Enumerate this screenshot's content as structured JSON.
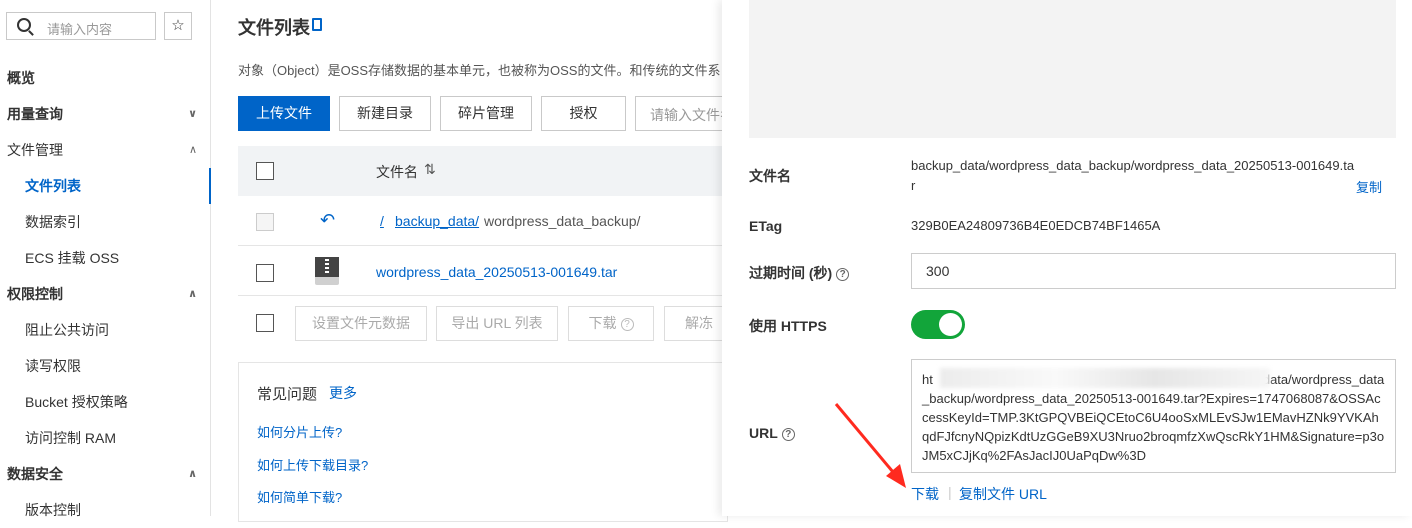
{
  "sidebar": {
    "search_placeholder": "请输入内容",
    "star_icon": "☆",
    "items": [
      {
        "label": "概览"
      },
      {
        "label": "用量查询"
      },
      {
        "label": "文件管理"
      },
      {
        "label": "文件列表"
      },
      {
        "label": "数据索引"
      },
      {
        "label": "ECS 挂载 OSS"
      },
      {
        "label": "权限控制"
      },
      {
        "label": "阻止公共访问"
      },
      {
        "label": "读写权限"
      },
      {
        "label": "Bucket 授权策略"
      },
      {
        "label": "访问控制 RAM"
      },
      {
        "label": "数据安全"
      },
      {
        "label": "版本控制"
      }
    ]
  },
  "main": {
    "title": "文件列表",
    "description": "对象（Object）是OSS存储数据的基本单元，也被称为OSS的文件。和传统的文件系",
    "buttons": {
      "upload": "上传文件",
      "new_dir": "新建目录",
      "fragments": "碎片管理",
      "authorize": "授权"
    },
    "search_placeholder": "请输入文件名",
    "table": {
      "col_name": "文件名",
      "sort_icon": "⇅",
      "breadcrumb_back_icon": "↶",
      "breadcrumb_root": "/",
      "breadcrumb_link": "backup_data/",
      "breadcrumb_current": "wordpress_data_backup/",
      "file_name": "wordpress_data_20250513-001649.tar"
    },
    "bulk": {
      "set_meta": "设置文件元数据",
      "export_url": "导出 URL 列表",
      "download": "下载",
      "unfreeze": "解冻"
    },
    "faq": {
      "title": "常见问题",
      "more": "更多",
      "q1": "如何分片上传?",
      "q2": "如何上传下载目录?",
      "q3": "如何简单下载?"
    }
  },
  "drawer": {
    "filename_label": "文件名",
    "filename_value": "backup_data/wordpress_data_backup/wordpress_data_20250513-001649.tar",
    "copy": "复制",
    "etag_label": "ETag",
    "etag_value": "329B0EA24809736B4E0EDCB74BF1465A",
    "expire_label": "过期时间 (秒)",
    "expire_value": "300",
    "https_label": "使用 HTTPS",
    "https_enabled": true,
    "url_label": "URL",
    "url_value_start": "ht",
    "url_value_visible": "data/wordpress_data_backup/wordpress_data_20250513-001649.tar?Expires=1747068087&OSSAccessKeyId=TMP.3KtGPQVBEiQCEtoC6U4ooSxMLEvSJw1EMavHZNk9YVKAhqdFJfcnyNQpizKdtUzGGeB9XU3Nruo2broqmfzXwQscRkY1HM&Signature=p3oJM5xCJjKq%2FAsJacIJ0UaPqDw%3D",
    "download": "下载",
    "copy_url": "复制文件 URL",
    "help_icon": "?",
    "arrow_color": "#ff2a1f",
    "toggle_color": "#12a53a"
  }
}
